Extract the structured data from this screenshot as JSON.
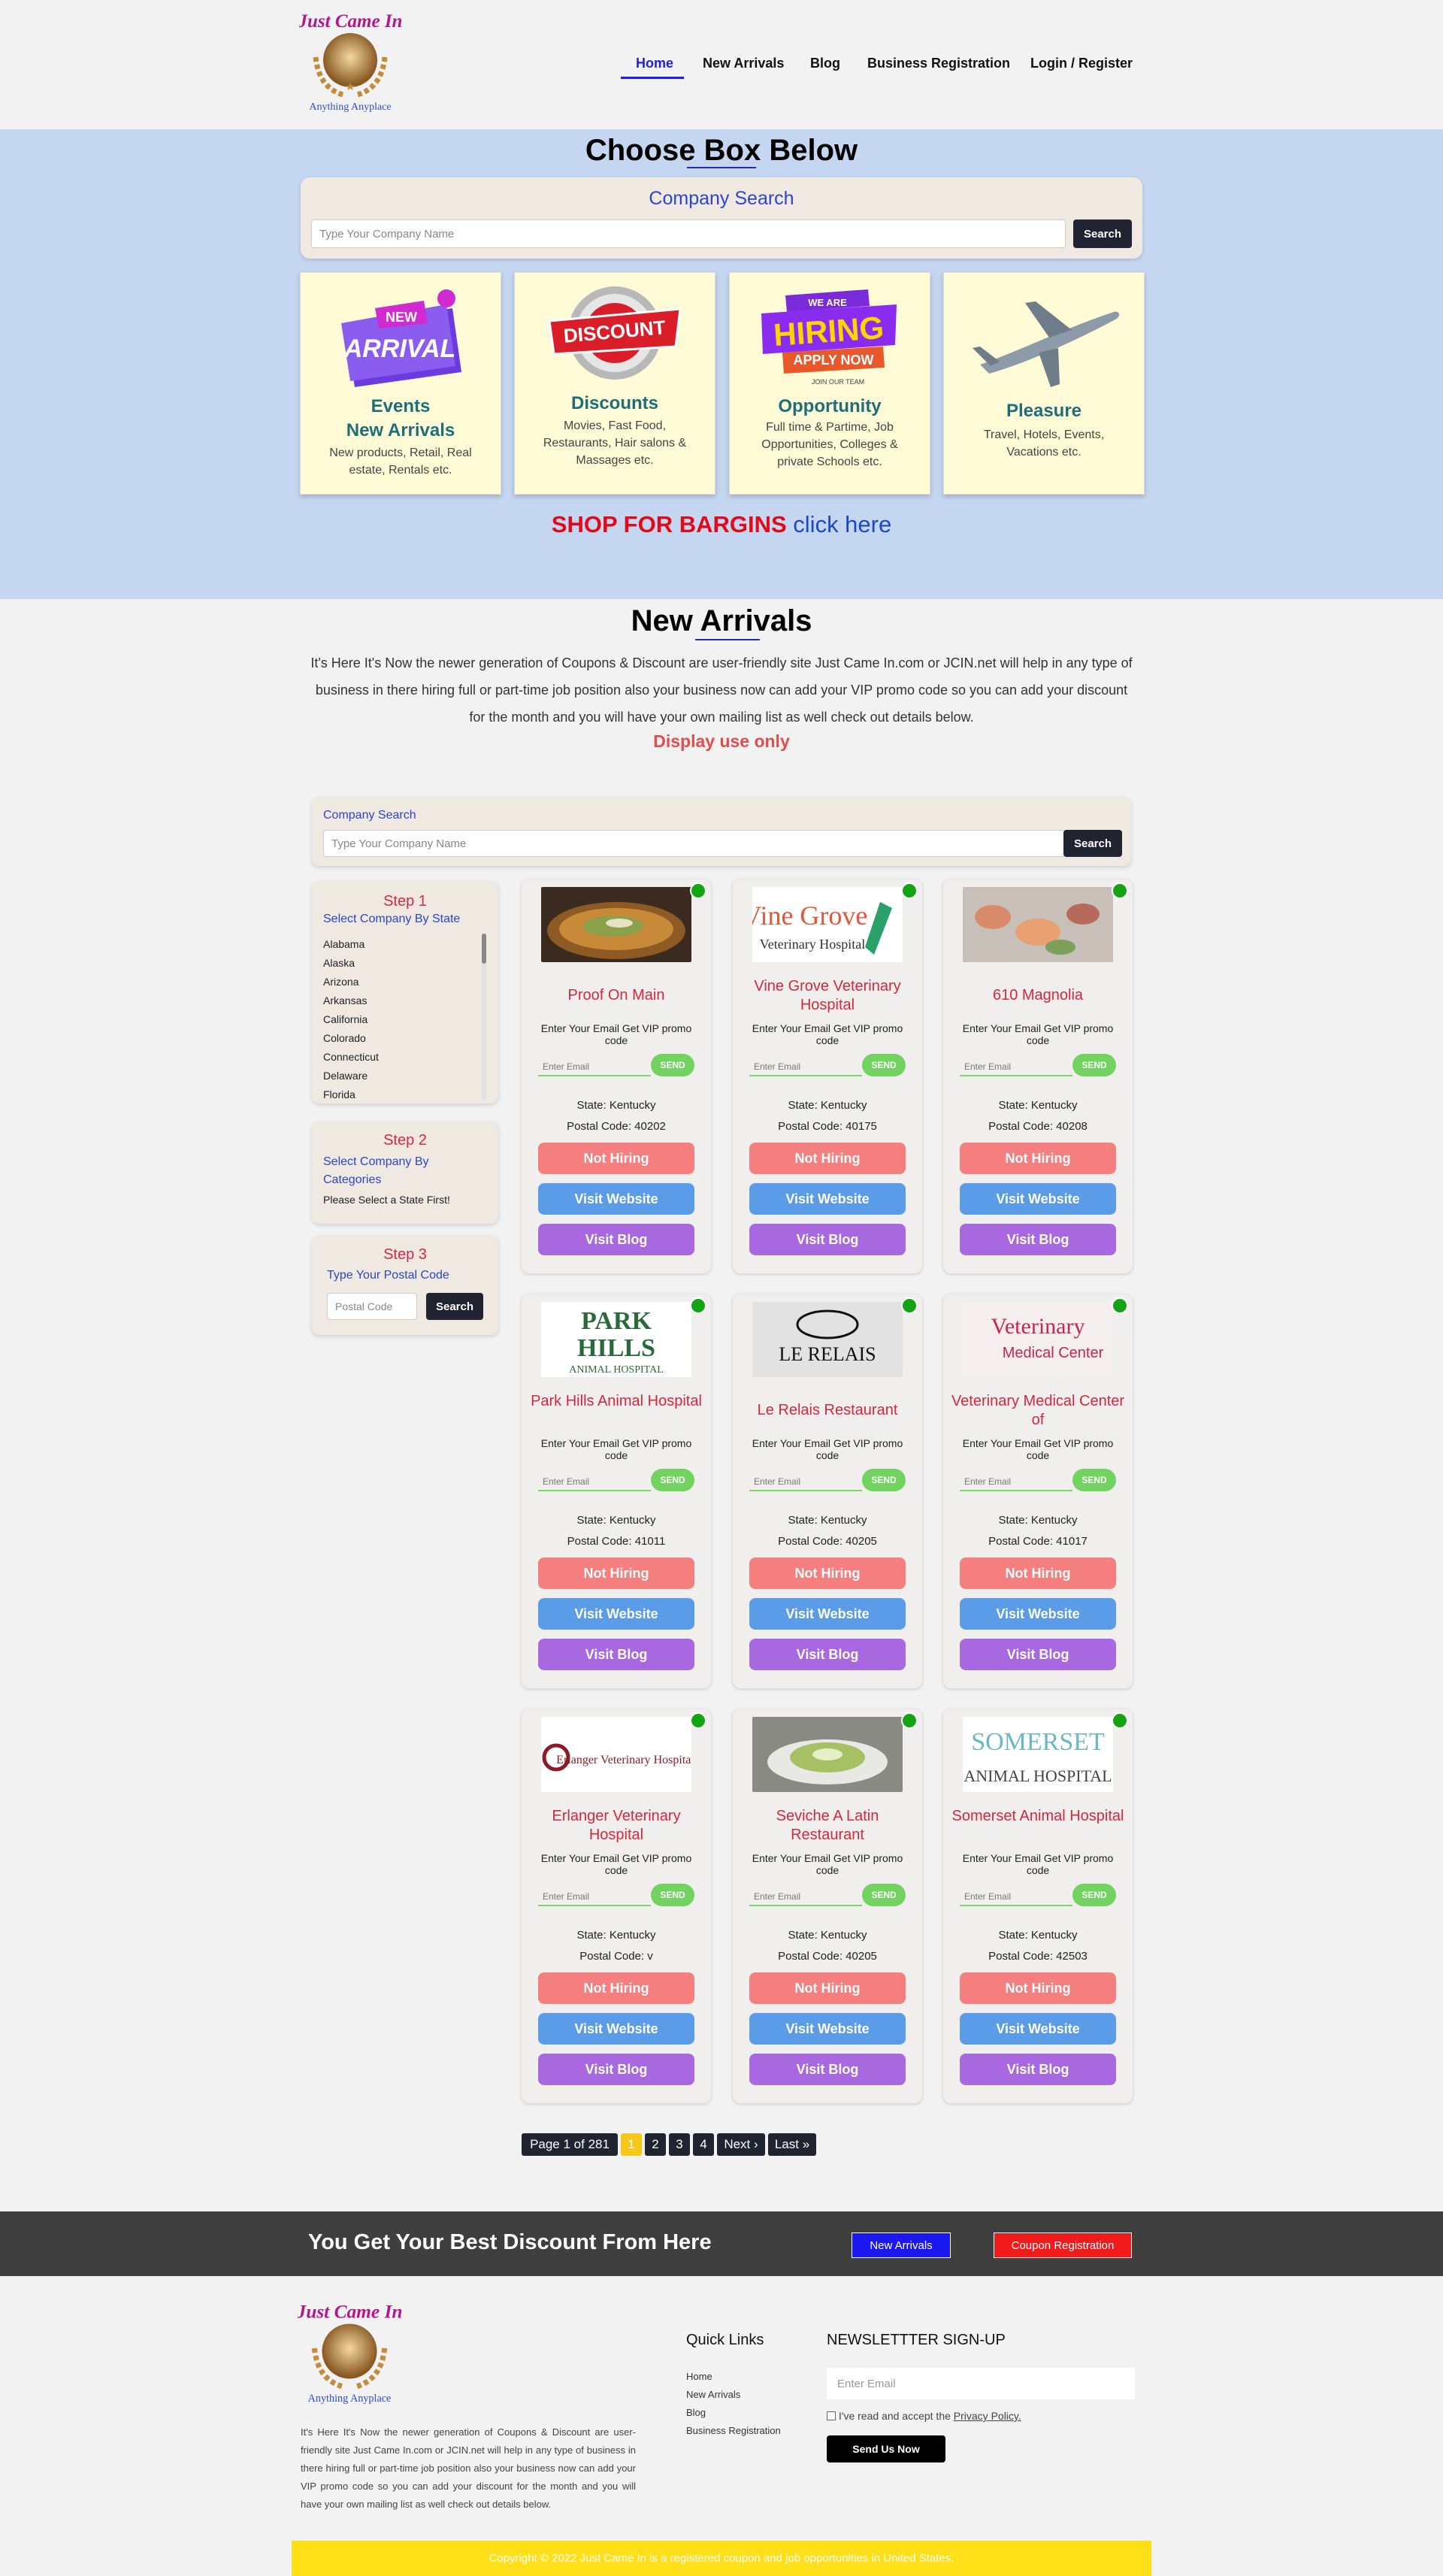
{
  "brand": {
    "logo_text_top": "Just Came In",
    "logo_text_bottom": "Anything  Anyplace"
  },
  "nav": {
    "items": [
      "Home",
      "New Arrivals",
      "Blog",
      "Business Registration",
      "Login / Register"
    ]
  },
  "hero": {
    "title": "Choose Box Below",
    "search_title": "Company Search",
    "search_placeholder": "Type Your Company Name",
    "search_button": "Search",
    "boxes": [
      {
        "icon": "new-arrival-tag-icon",
        "badge_top": "NEW",
        "badge_main": "ARRIVAL",
        "title_line1": "Events",
        "title_line2": "New Arrivals",
        "desc": "New products, Retail, Real estate, Rentals etc."
      },
      {
        "icon": "discount-badge-icon",
        "badge_main": "DISCOUNT",
        "title_line1": "Discounts",
        "desc": "Movies, Fast Food, Restaurants, Hair salons & Massages etc."
      },
      {
        "icon": "hiring-sign-icon",
        "badge_top": "WE ARE",
        "badge_main": "HIRING",
        "badge_sub": "APPLY NOW",
        "badge_small": "JOIN OUR TEAM",
        "title_line1": "Opportunity",
        "desc": "Full time & Partime, Job Opportunities, Colleges & private Schools etc."
      },
      {
        "icon": "airplane-icon",
        "title_line1": "Pleasure",
        "desc": "Travel, Hotels, Events, Vacations etc."
      }
    ],
    "shop_text": "SHOP FOR BARGINS",
    "shop_link": "click here"
  },
  "new_arrivals": {
    "title": "New Arrivals",
    "text": "It's Here It's Now the newer generation of Coupons & Discount are user-friendly site Just Came In.com or JCIN.net will help in any type of business in there hiring full or part-time job position also your business now can add your VIP promo code so you can add your discount for the month and you will have your own mailing list as well check out details below.",
    "display": "Display use only"
  },
  "company_search": {
    "title": "Company Search",
    "placeholder": "Type Your Company Name",
    "button": "Search"
  },
  "steps": {
    "step1_title": "Step 1",
    "step1_sub": "Select Company By State",
    "states": [
      "Alabama",
      "Alaska",
      "Arizona",
      "Arkansas",
      "California",
      "Colorado",
      "Connecticut",
      "Delaware",
      "Florida"
    ],
    "step2_title": "Step 2",
    "step2_sub": "Select Company By Categories",
    "step2_note": "Please Select a State First!",
    "step3_title": "Step 3",
    "step3_sub": "Type Your Postal Code",
    "postal_placeholder": "Postal Code",
    "postal_button": "Search"
  },
  "card_labels": {
    "promo": "Enter Your Email Get VIP promo code",
    "email_placeholder": "Enter Email",
    "send": "SEND",
    "state_label": "State:",
    "postal_label": "Postal Code:",
    "hiring": "Not Hiring",
    "website": "Visit Website",
    "blog": "Visit Blog"
  },
  "cards": [
    {
      "name": "Proof On Main",
      "state": "Kentucky",
      "postal": "40202",
      "image": "food-plate-photo"
    },
    {
      "name": "Vine Grove Veterinary Hospital",
      "state": "Kentucky",
      "postal": "40175",
      "image": "vine-grove-logo",
      "logo_line1": "Vine Grove",
      "logo_line2": "Veterinary Hospital"
    },
    {
      "name": "610 Magnolia",
      "state": "Kentucky",
      "postal": "40208",
      "image": "food-platter-photo"
    },
    {
      "name": "Park Hills Animal Hospital",
      "state": "Kentucky",
      "postal": "41011",
      "image": "park-hills-logo",
      "logo_line1": "PARK",
      "logo_line2": "HILLS",
      "logo_line3": "ANIMAL HOSPITAL"
    },
    {
      "name": "Le Relais Restaurant",
      "state": "Kentucky",
      "postal": "40205",
      "image": "le-relais-logo",
      "logo_line1": "LE RELAIS"
    },
    {
      "name": "Veterinary Medical Center of",
      "state": "Kentucky",
      "postal": "41017",
      "image": "veterinary-medical-logo",
      "logo_line1": "Veterinary",
      "logo_line2": "Medical Center"
    },
    {
      "name": "Erlanger Veterinary Hospital",
      "state": "Kentucky",
      "postal": "v",
      "image": "erlanger-logo",
      "logo_line1": "Erlanger Veterinary Hospital"
    },
    {
      "name": "Seviche A Latin Restaurant",
      "state": "Kentucky",
      "postal": "40205",
      "image": "soup-bowl-photo"
    },
    {
      "name": "Somerset Animal Hospital",
      "state": "Kentucky",
      "postal": "42503",
      "image": "somerset-logo",
      "logo_line1": "SOMERSET",
      "logo_line2": "ANIMAL HOSPITAL"
    }
  ],
  "pagination": {
    "label": "Page 1 of 281",
    "pages": [
      "1",
      "2",
      "3",
      "4"
    ],
    "next": "Next ›",
    "last": "Last »"
  },
  "banner": {
    "text": "You Get Your Best Discount From Here",
    "btn_new_arrivals": "New Arrivals",
    "btn_coupon": "Coupon Registration"
  },
  "footer": {
    "desc": "It's Here It's Now the newer generation of Coupons & Discount are user-friendly site Just Came In.com or JCIN.net will help in any type of business in there hiring full or part-time job position also your business now can add your VIP promo code so you can add your discount for the month and you will have your own mailing list as well check out details below.",
    "quick_links_title": "Quick Links",
    "links": [
      "Home",
      "New Arrivals",
      "Blog",
      "Business Registration"
    ],
    "newsletter_title": "NEWSLETTTER SIGN-UP",
    "email_placeholder": "Enter Email",
    "agree_text": "I've read and accept the ",
    "policy_link": "Privacy Policy.",
    "send_button": "Send Us Now",
    "copyright": "Copyright © 2022 Just Came In is a registered coupon and job opportunities in United States."
  },
  "colors": {
    "hero_bg": "#c5d7f0",
    "accent_blue": "#1d1ee6",
    "card_name": "#d4283c",
    "not_hiring": "#f57e7e",
    "visit_website": "#5b9ce8",
    "visit_blog": "#a868e0",
    "send_green": "#72d361",
    "copyright_bg": "#ffdf17"
  }
}
